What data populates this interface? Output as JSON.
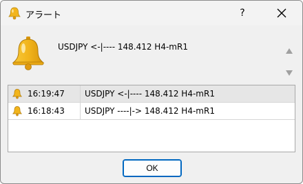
{
  "window": {
    "title": "アラート",
    "help_label": "?"
  },
  "message": {
    "text": "USDJPY <-|---- 148.412 H4-mR1"
  },
  "alerts": [
    {
      "time": "16:19:47",
      "text": "USDJPY <-|---- 148.412 H4-mR1",
      "selected": true
    },
    {
      "time": "16:18:43",
      "text": "USDJPY ----|-> 148.412 H4-mR1",
      "selected": false
    }
  ],
  "buttons": {
    "ok_label": "OK"
  },
  "icons": {
    "title": "bell-icon",
    "message": "bell-icon",
    "row": "bell-icon",
    "close": "close-icon",
    "scroll_up": "scroll-up-icon",
    "scroll_down": "scroll-down-icon"
  },
  "colors": {
    "bell": "#f2b51c",
    "accent": "#0067c0"
  }
}
